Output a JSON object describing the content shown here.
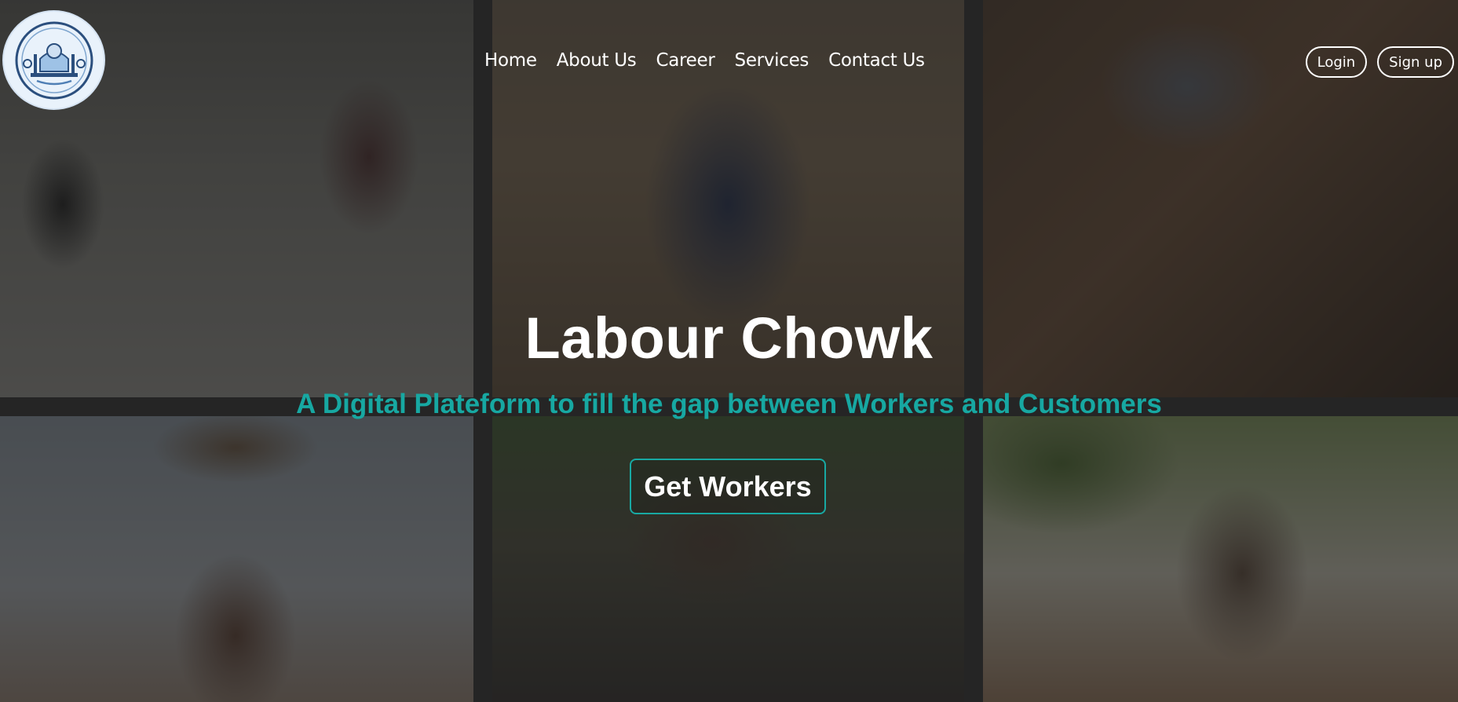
{
  "brand": {
    "logo_icon": "taj-mahal-worker-logo-icon"
  },
  "nav": {
    "items": [
      {
        "label": "Home"
      },
      {
        "label": "About Us"
      },
      {
        "label": "Career"
      },
      {
        "label": "Services"
      },
      {
        "label": "Contact Us"
      }
    ]
  },
  "auth": {
    "login_label": "Login",
    "signup_label": "Sign up"
  },
  "hero": {
    "title": "Labour Chowk",
    "subtitle": "A Digital Plateform to fill the gap between Workers and Customers",
    "cta_label": "Get Workers"
  },
  "colors": {
    "accent": "#17a8a2",
    "text": "#ffffff",
    "overlay": "#161616"
  }
}
